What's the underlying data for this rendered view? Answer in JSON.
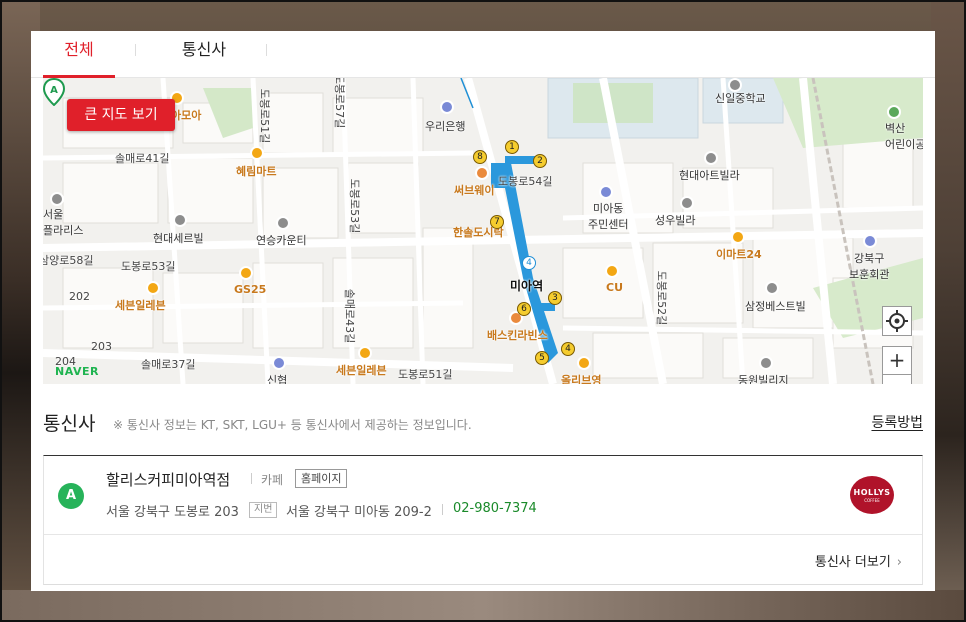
{
  "tabs": [
    {
      "label": "전체",
      "active": true
    },
    {
      "label": "통신사",
      "active": false
    }
  ],
  "map": {
    "big_map_button": "큰 지도 보기",
    "provider_logo": "NAVER",
    "zoom_in": "+",
    "zoom_out": "−",
    "station_name": "미아역",
    "marker_letter": "A",
    "labels": {
      "amoa": "아모아",
      "hyerim": "혜림마트",
      "woori": "우리은행",
      "subway": "써브웨이",
      "hansol": "한솔도시락",
      "seoul_clinic": "서울\n플라리스",
      "hyundai_ceri": "현대세르빌",
      "yeonseung": "연승카운티",
      "hyundai_art": "현대아트빌라",
      "mia_center": "미아동\n주민센터",
      "seongwoo": "성우빌라",
      "sinil_school": "신일중학교",
      "byeoksan": "벽산\n어린이공",
      "gangbuk_hall": "강북구\n보훈회관",
      "emart24": "이마트24",
      "cu": "CU",
      "samjeong": "삼정베스트빌",
      "gs25": "GS25",
      "seven1": "세븐일레븐",
      "seven2": "세븐일레븐",
      "baskin": "배스킨라빈스",
      "olive": "올리브영",
      "dongwon": "동원빌리지",
      "sinhyup": "신협",
      "r_dobong51": "도봉로51길",
      "r_dobong57": "도봉로57길",
      "r_solmae41": "솔매로41길",
      "r_dobong53": "도봉로53길",
      "r_dobong54": "도봉로54길",
      "r_yangro58": "삼양로58길",
      "r_dobong53b": "도봉로53길",
      "r_solmae43": "솔매로43길",
      "r_solmae37": "솔매로37길",
      "r_dobong51b": "도봉로51길",
      "r_dobong52": "도봉로52길",
      "n202": "202",
      "n203": "203",
      "n204": "204"
    }
  },
  "section": {
    "title": "통신사",
    "note": "※ 통신사 정보는 KT, SKT, LGU+ 등 통신사에서 제공하는 정보입니다.",
    "register_link": "등록방법"
  },
  "listing": {
    "badge": "A",
    "name": "할리스커피미아역점",
    "category": "카페",
    "homepage_label": "홈페이지",
    "road_address": "서울 강북구 도봉로 203",
    "jibun_tag": "지번",
    "jibun_address": "서울 강북구 미아동 209-2",
    "phone": "02-980-7374",
    "logo_text": "HOLLYS",
    "logo_sub": "COFFEE"
  },
  "more_link": "통신사 더보기",
  "colors": {
    "accent": "#e0202a",
    "badge_green": "#27b35a",
    "phone_green": "#1a8a2a",
    "subway_line": "#1f8fd6"
  }
}
